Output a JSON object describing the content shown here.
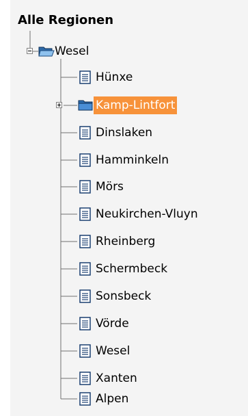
{
  "tree": {
    "title": "Alle Regionen",
    "root": {
      "label": "Wesel",
      "expanded": true,
      "icon": "open-folder-icon"
    },
    "children": [
      {
        "label": "Hünxe",
        "type": "document",
        "icon": "document-icon"
      },
      {
        "label": "Kamp-Lintfort",
        "type": "folder",
        "expanded": false,
        "selected": true,
        "icon": "folder-icon"
      },
      {
        "label": "Dinslaken",
        "type": "document",
        "icon": "document-icon"
      },
      {
        "label": "Hamminkeln",
        "type": "document",
        "icon": "document-icon"
      },
      {
        "label": "Mörs",
        "type": "document",
        "icon": "document-icon"
      },
      {
        "label": "Neukirchen-Vluyn",
        "type": "document",
        "icon": "document-icon"
      },
      {
        "label": "Rheinberg",
        "type": "document",
        "icon": "document-icon"
      },
      {
        "label": "Schermbeck",
        "type": "document",
        "icon": "document-icon"
      },
      {
        "label": "Sonsbeck",
        "type": "document",
        "icon": "document-icon"
      },
      {
        "label": "Vörde",
        "type": "document",
        "icon": "document-icon"
      },
      {
        "label": "Wesel",
        "type": "document",
        "icon": "document-icon"
      },
      {
        "label": "Xanten",
        "type": "document",
        "icon": "document-icon"
      },
      {
        "label": "Alpen",
        "type": "document",
        "icon": "document-icon"
      }
    ]
  },
  "colors": {
    "panel_background": "#f4f4f4",
    "selection_background": "#f7923a",
    "selection_text": "#ffffff",
    "tree_line": "#707070"
  }
}
